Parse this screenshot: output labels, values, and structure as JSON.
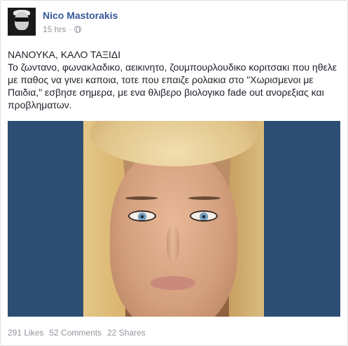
{
  "post": {
    "author": "Nico Mastorakis",
    "time": "15 hrs",
    "separator": "·",
    "text_lines": [
      "ΝΑΝΟΥΚΑ, ΚΑΛΟ ΤΑΞΙΔΙ",
      "Το ζωντανο, φωνακλαδικο, αεικινητο, ζουμπουρλουδικο κοριτσακι που ηθελε με παθος να γινει καποια, τοτε που επαιζε ρολακια στο \"Χωρισμενοι με Παιδια,\" εσβησε σημερα, με ενα θλιβερο βιολογικο fade out ανορεξιας και προβληματων."
    ],
    "privacy_icon": "globe-icon"
  },
  "stats": {
    "likes": "291 Likes",
    "comments": "52 Comments",
    "shares": "22 Shares"
  },
  "colors": {
    "author_link": "#365899",
    "meta_text": "#90949c",
    "photo_background": "#2c4e73"
  }
}
